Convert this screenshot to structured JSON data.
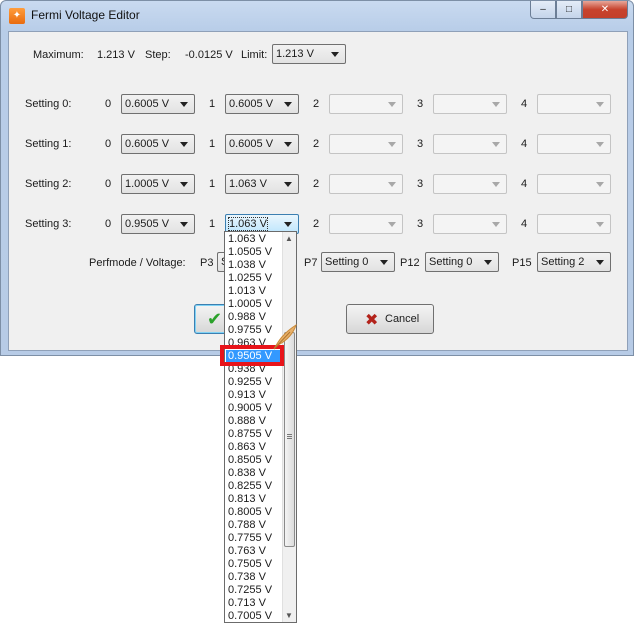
{
  "window": {
    "title": "Fermi Voltage Editor",
    "icon": "app-icon",
    "min": "–",
    "max": "□",
    "close": "✕"
  },
  "top": {
    "maximum_label": "Maximum:",
    "maximum_value": "1.213 V",
    "step_label": "Step:",
    "step_value": "-0.0125 V",
    "limit_label": "Limit:",
    "limit_value": "1.213 V"
  },
  "slot_numbers": [
    "0",
    "1",
    "2",
    "3",
    "4"
  ],
  "settings": [
    {
      "label": "Setting 0:",
      "values": [
        "0.6005 V",
        "0.6005 V",
        "",
        "",
        ""
      ]
    },
    {
      "label": "Setting 1:",
      "values": [
        "0.6005 V",
        "0.6005 V",
        "",
        "",
        ""
      ]
    },
    {
      "label": "Setting 2:",
      "values": [
        "1.0005 V",
        "1.063 V",
        "",
        "",
        ""
      ]
    },
    {
      "label": "Setting 3:",
      "values": [
        "0.9505 V",
        "1.063 V",
        "",
        "",
        ""
      ]
    }
  ],
  "perf": {
    "label": "Perfmode / Voltage:",
    "p3_label": "P3",
    "p3_value": "S",
    "p7_label": "P7",
    "p7_value": "Setting 0",
    "p12_label": "P12",
    "p12_value": "Setting 0",
    "p15_label": "P15",
    "p15_value": "Setting 2"
  },
  "buttons": {
    "ok_icon": "check-icon",
    "cancel_icon": "x-icon",
    "cancel_label": "Cancel"
  },
  "dropdown": {
    "items": [
      "1.063 V",
      "1.0505 V",
      "1.038 V",
      "1.0255 V",
      "1.013 V",
      "1.0005 V",
      "0.988 V",
      "0.9755 V",
      "0.963 V",
      "0.9505 V",
      "0.938 V",
      "0.9255 V",
      "0.913 V",
      "0.9005 V",
      "0.888 V",
      "0.8755 V",
      "0.863 V",
      "0.8505 V",
      "0.838 V",
      "0.8255 V",
      "0.813 V",
      "0.8005 V",
      "0.788 V",
      "0.7755 V",
      "0.763 V",
      "0.7505 V",
      "0.738 V",
      "0.7255 V",
      "0.713 V",
      "0.7005 V"
    ],
    "selected_index": 9
  },
  "colors": {
    "selection": "#3399ff",
    "highlight": "#e8141a"
  }
}
